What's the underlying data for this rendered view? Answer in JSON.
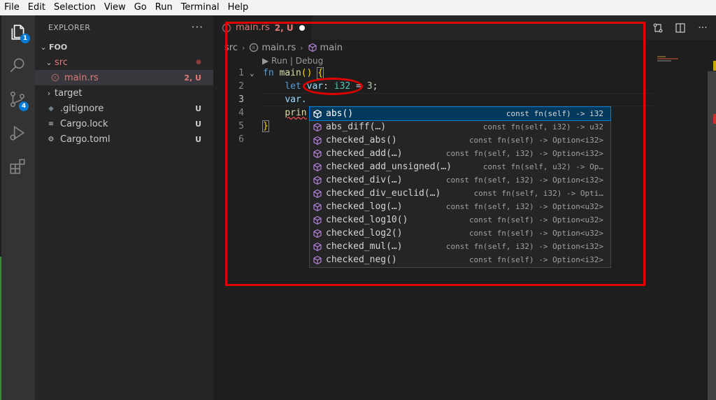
{
  "menu": [
    "File",
    "Edit",
    "Selection",
    "View",
    "Go",
    "Run",
    "Terminal",
    "Help"
  ],
  "activity": {
    "explorer_badge": "1",
    "scm_badge": "4"
  },
  "sidebar": {
    "title": "EXPLORER",
    "more": "···",
    "folder": "FOO",
    "items": [
      {
        "label": "src",
        "status": "●"
      },
      {
        "label": "main.rs",
        "status": "2, U"
      },
      {
        "label": "target",
        "status": ""
      },
      {
        "label": ".gitignore",
        "status": "U"
      },
      {
        "label": "Cargo.lock",
        "status": "U"
      },
      {
        "label": "Cargo.toml",
        "status": "U"
      }
    ]
  },
  "tab": {
    "name": "main.rs",
    "status": "2, U"
  },
  "breadcrumbs": [
    "src",
    "main.rs",
    "main"
  ],
  "codelens": "▶ Run | Debug",
  "code": {
    "line_numbers": [
      "1",
      "2",
      "3",
      "4",
      "5",
      "6"
    ],
    "l1_fn": "fn",
    "l1_name": "main",
    "l1_parens": "()",
    "l1_brace": "{",
    "l2_let": "let",
    "l2_var": "var",
    "l2_colon": ":",
    "l2_type": "i32",
    "l2_eq": " = ",
    "l2_num": "3",
    "l2_semi": ";",
    "l3_text": "var.",
    "l4_text": "prin",
    "l5_brace": "}"
  },
  "suggest": [
    {
      "label": "abs()",
      "detail": "const fn(self) -> i32"
    },
    {
      "label": "abs_diff(…)",
      "detail": "const fn(self, i32) -> u32"
    },
    {
      "label": "checked_abs()",
      "detail": "const fn(self) -> Option<i32>"
    },
    {
      "label": "checked_add(…)",
      "detail": "const fn(self, i32) -> Option<i32>"
    },
    {
      "label": "checked_add_unsigned(…)",
      "detail": "const fn(self, u32) -> Op…"
    },
    {
      "label": "checked_div(…)",
      "detail": "const fn(self, i32) -> Option<i32>"
    },
    {
      "label": "checked_div_euclid(…)",
      "detail": "const fn(self, i32) -> Opti…"
    },
    {
      "label": "checked_log(…)",
      "detail": "const fn(self, i32) -> Option<u32>"
    },
    {
      "label": "checked_log10()",
      "detail": "const fn(self) -> Option<u32>"
    },
    {
      "label": "checked_log2()",
      "detail": "const fn(self) -> Option<u32>"
    },
    {
      "label": "checked_mul(…)",
      "detail": "const fn(self, i32) -> Option<i32>"
    },
    {
      "label": "checked_neg()",
      "detail": "const fn(self) -> Option<i32>"
    }
  ],
  "colors": {
    "accent": "#0078d4",
    "annotation": "#e00000",
    "git_untracked": "#e07a7a"
  }
}
